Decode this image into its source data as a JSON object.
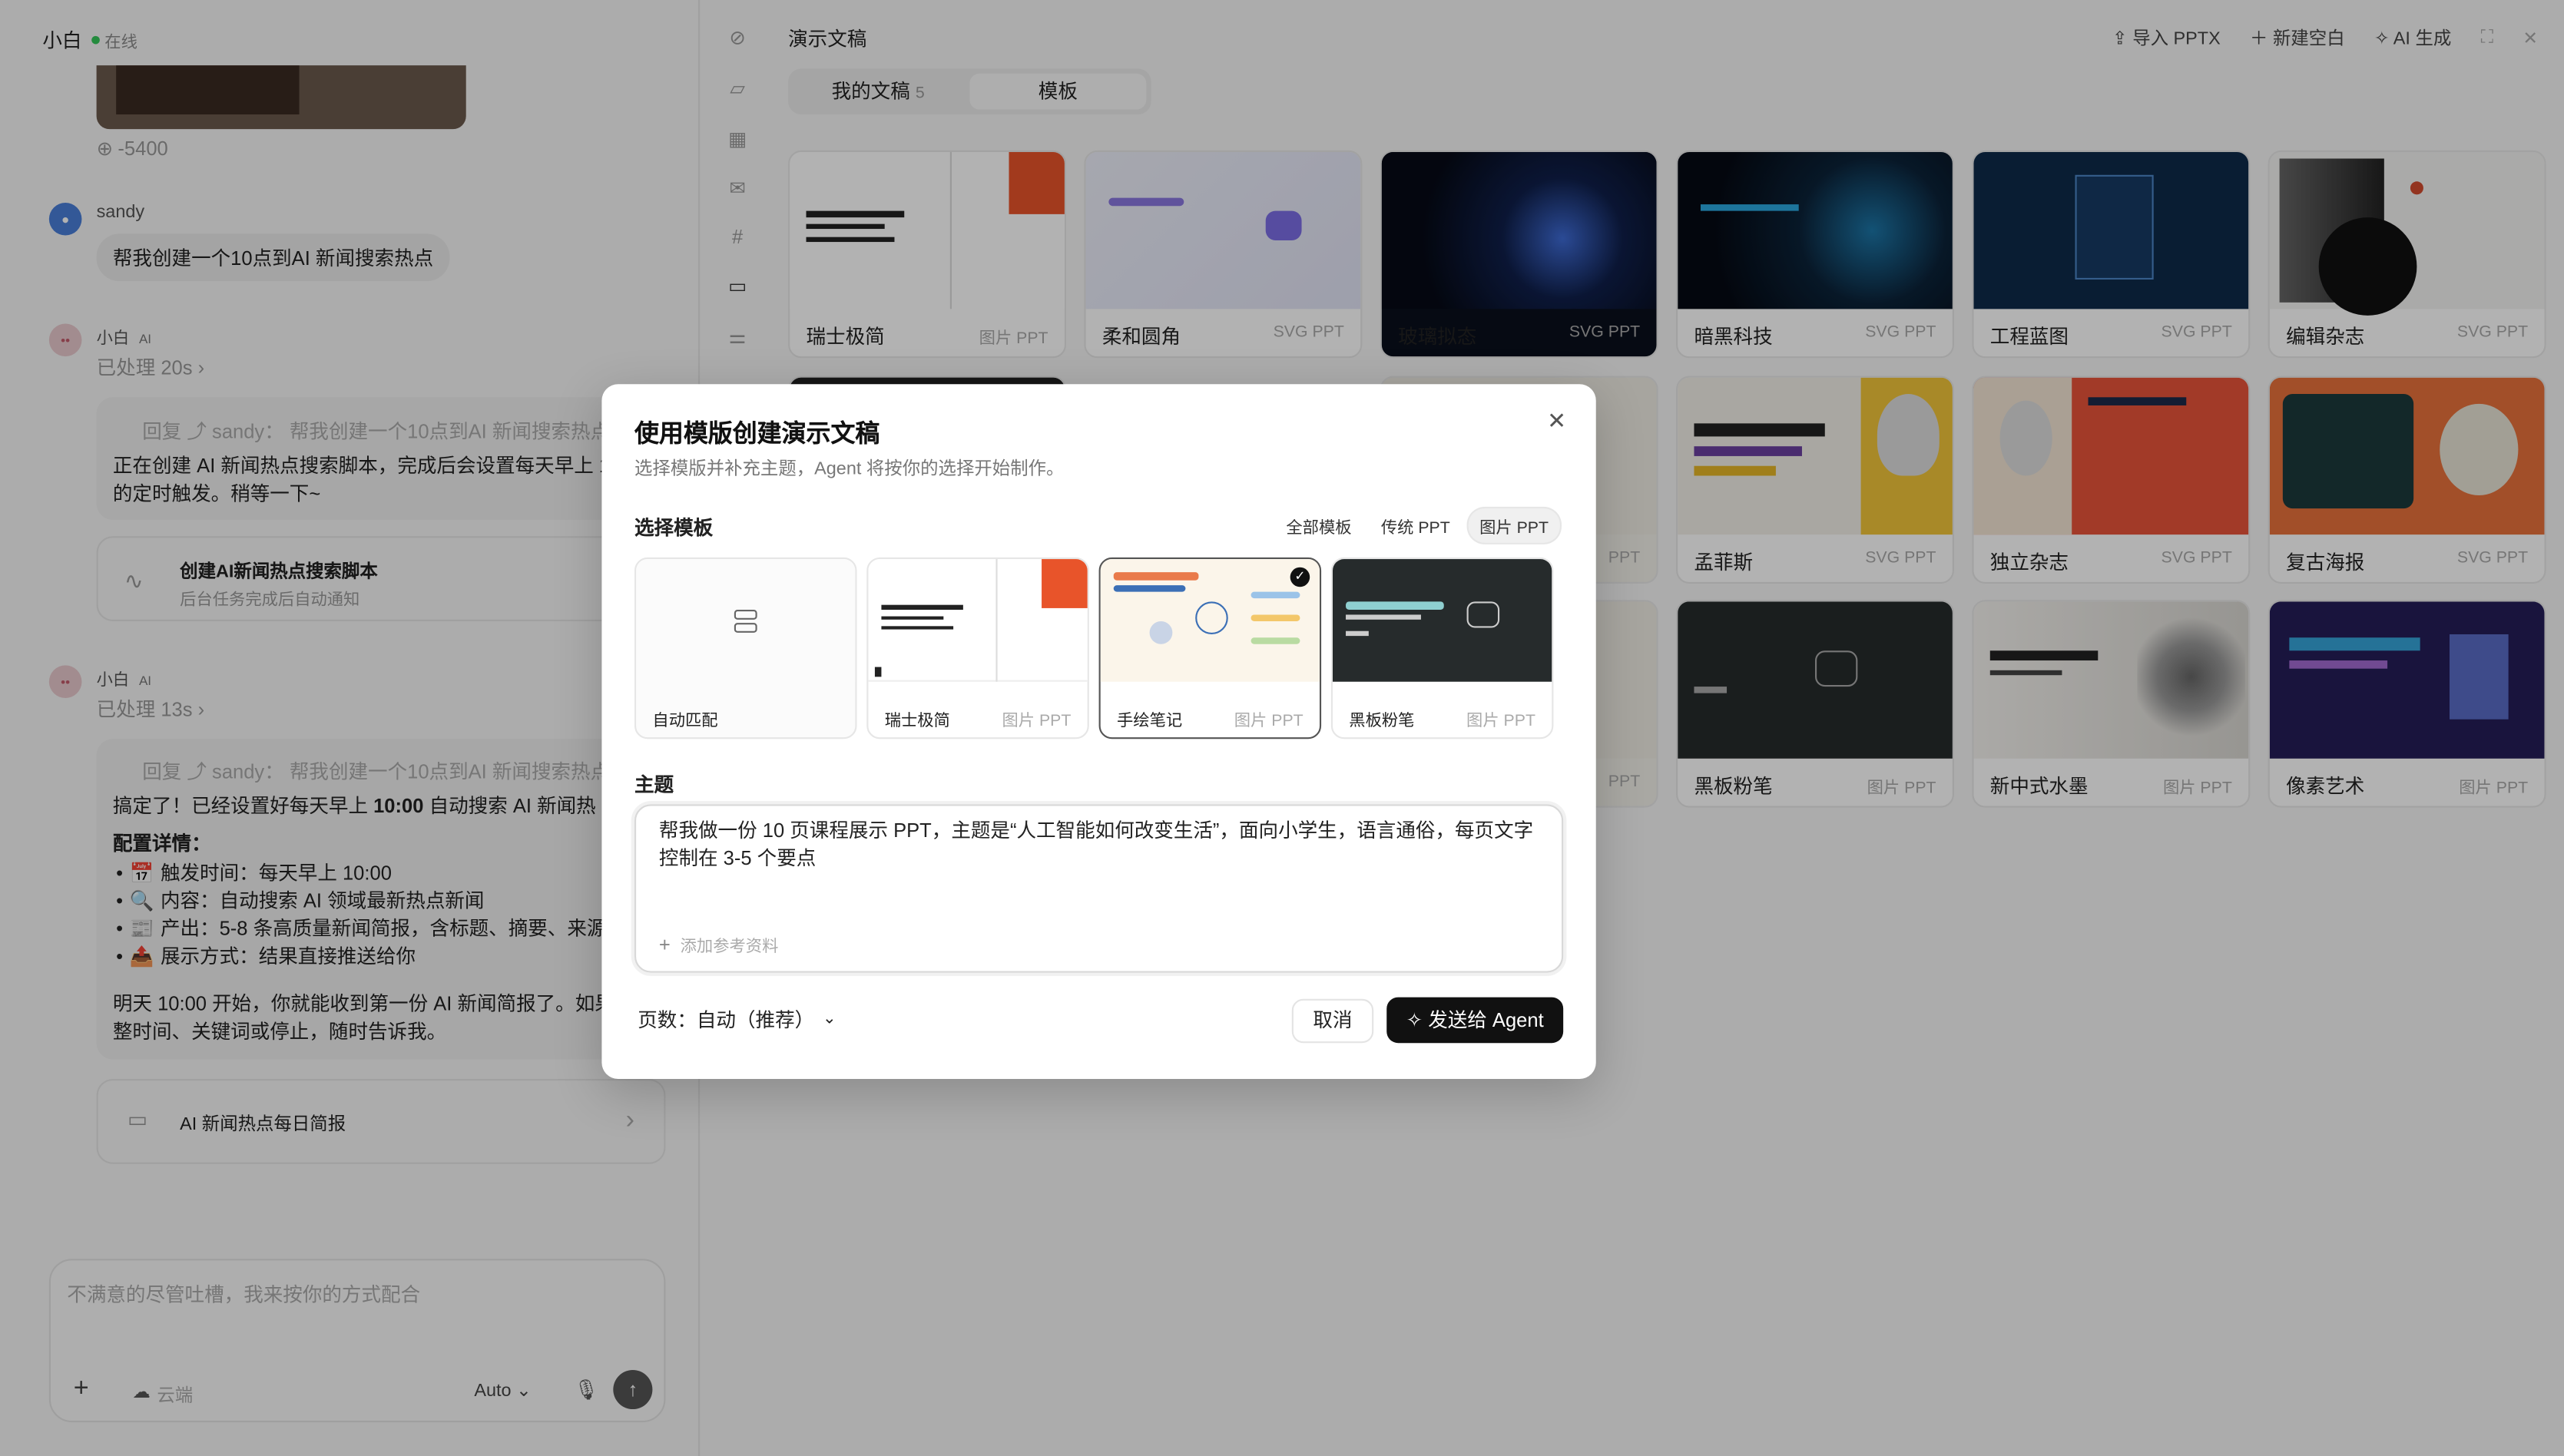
{
  "chat": {
    "user_name": "小白",
    "status": "在线",
    "credit": "-5400",
    "user_msg_name": "sandy",
    "user_msg": "帮我创建一个10点到AI 新闻搜索热点",
    "ai_name": "小白",
    "ai_tag": "AI",
    "processed_1": "已处理 20s",
    "quote_1": "回复 ⤴ sandy： 帮我创建一个10点到AI 新闻搜索热点",
    "reply_1_line1": "正在创建 AI 新闻热点搜索脚本，完成后会设置每天早上 1",
    "reply_1_line2": "的定时触发。稍等一下~",
    "task_title": "创建AI新闻热点搜索脚本",
    "task_sub": "后台任务完成后自动通知",
    "processed_2": "已处理 13s",
    "quote_2": "回复 ⤴ sandy： 帮我创建一个10点到AI 新闻搜索热点",
    "reply_2_line1_a": "搞定了！已经设置好每天早上 ",
    "reply_2_line1_b": "10:00",
    "reply_2_line1_c": " 自动搜索 AI 新闻热",
    "config_title": "配置详情：",
    "config_items": [
      {
        "icon": "📅",
        "text": "触发时间：每天早上 10:00"
      },
      {
        "icon": "🔍",
        "text": "内容：自动搜索 AI 领域最新热点新闻"
      },
      {
        "icon": "📰",
        "text": "产出：5-8 条高质量新闻简报，含标题、摘要、来源"
      },
      {
        "icon": "📤",
        "text": "展示方式：结果直接推送给你"
      }
    ],
    "reply_2_tail_1": "明天 10:00 开始，你就能收到第一份 AI 新闻简报了。如果",
    "reply_2_tail_2": "整时间、关键词或停止，随时告诉我。",
    "daily_card": "AI 新闻热点每日简报",
    "composer_placeholder": "不满意的尽管吐槽，我来按你的方式配合",
    "cloud_label": "云端",
    "model_label": "Auto"
  },
  "main": {
    "title": "演示文稿",
    "actions": [
      "导入 PPTX",
      "新建空白",
      "AI 生成"
    ],
    "tabs": [
      {
        "label": "我的文稿",
        "count": "5"
      },
      {
        "label": "模板"
      }
    ],
    "templates": [
      {
        "name": "瑞士极简",
        "type": "图片 PPT"
      },
      {
        "name": "柔和圆角",
        "type": "SVG PPT"
      },
      {
        "name": "玻璃拟态",
        "type": "SVG PPT"
      },
      {
        "name": "暗黑科技",
        "type": "SVG PPT"
      },
      {
        "name": "工程蓝图",
        "type": "SVG PPT"
      },
      {
        "name": "编辑杂志",
        "type": "SVG PPT"
      },
      {
        "name": "",
        "type": "PPT"
      },
      {
        "name": "孟菲斯",
        "type": "SVG PPT"
      },
      {
        "name": "独立杂志",
        "type": "SVG PPT"
      },
      {
        "name": "复古海报",
        "type": "SVG PPT"
      },
      {
        "name": "",
        "type": "PPT"
      },
      {
        "name": "黑板粉笔",
        "type": "图片 PPT"
      },
      {
        "name": "新中式水墨",
        "type": "图片 PPT"
      },
      {
        "name": "像素艺术",
        "type": "图片 PPT"
      }
    ]
  },
  "modal": {
    "title": "使用模版创建演示文稿",
    "desc": "选择模版并补充主题，Agent 将按你的选择开始制作。",
    "select_label": "选择模板",
    "filters": [
      "全部模板",
      "传统 PPT",
      "图片 PPT"
    ],
    "cards": [
      {
        "name": "自动匹配",
        "type": ""
      },
      {
        "name": "瑞士极简",
        "type": "图片 PPT"
      },
      {
        "name": "手绘笔记",
        "type": "图片 PPT"
      },
      {
        "name": "黑板粉笔",
        "type": "图片 PPT"
      }
    ],
    "topic_label": "主题",
    "topic_value": "帮我做一份 10 页课程展示 PPT，主题是“人工智能如何改变生活”，面向小学生，语言通俗，每页文字控制在 3-5 个要点",
    "add_ref": "添加参考资料",
    "pages_label": "页数：自动（推荐）",
    "cancel": "取消",
    "send": "发送给 Agent"
  }
}
